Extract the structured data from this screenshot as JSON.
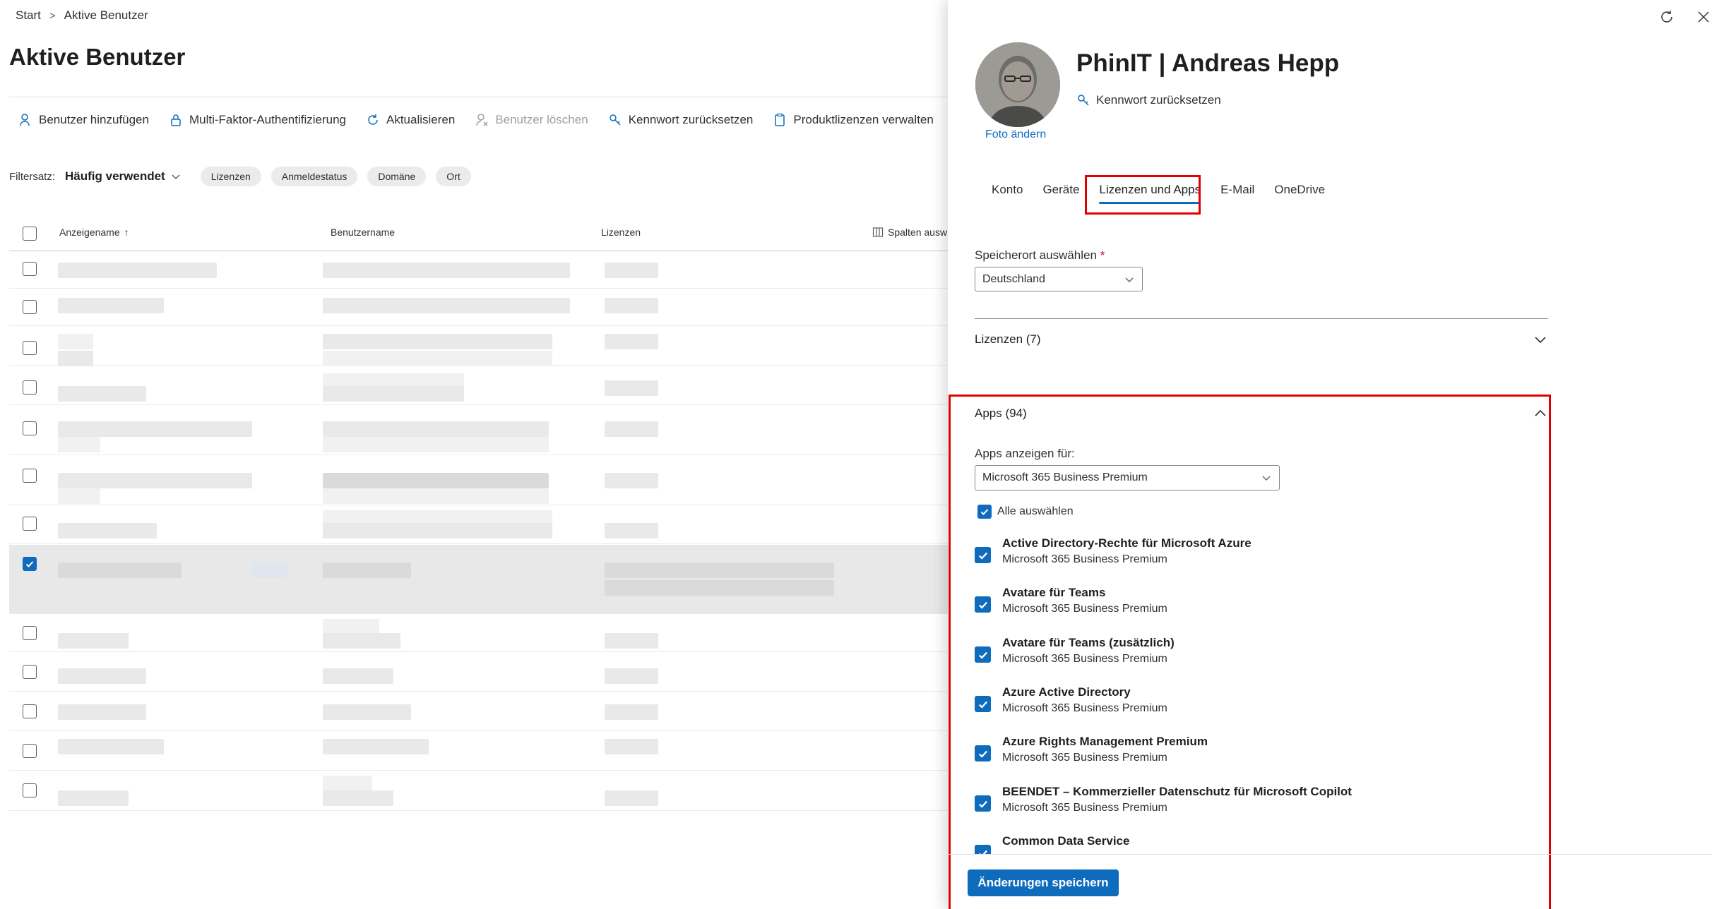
{
  "breadcrumb": {
    "home": "Start",
    "current": "Aktive Benutzer"
  },
  "page": {
    "title": "Aktive Benutzer"
  },
  "toolbar": {
    "add_user": "Benutzer hinzufügen",
    "mfa": "Multi-Faktor-Authentifizierung",
    "refresh": "Aktualisieren",
    "delete_user": "Benutzer löschen",
    "reset_password": "Kennwort zurücksetzen",
    "manage_licenses": "Produktlizenzen verwalten"
  },
  "filter": {
    "label": "Filtersatz:",
    "selected": "Häufig verwendet",
    "pills": [
      "Lizenzen",
      "Anmeldestatus",
      "Domäne",
      "Ort"
    ]
  },
  "table": {
    "columns": {
      "display_name": "Anzeigename",
      "username": "Benutzername",
      "licenses": "Lizenzen",
      "choose_columns": "Spalten ausw"
    }
  },
  "panel": {
    "user_name": "PhinIT | Andreas Hepp",
    "change_photo": "Foto ändern",
    "reset_password": "Kennwort zurücksetzen",
    "tabs": [
      "Konto",
      "Geräte",
      "Lizenzen und Apps",
      "E-Mail",
      "OneDrive"
    ],
    "active_tab": "Lizenzen und Apps",
    "location_label": "Speicherort auswählen",
    "location_required": "*",
    "location_value": "Deutschland",
    "licenses_header": "Lizenzen (7)",
    "apps_header": "Apps (94)",
    "apps_show_for_label": "Apps anzeigen für:",
    "apps_show_for_value": "Microsoft 365 Business Premium",
    "select_all": "Alle auswählen",
    "apps": [
      {
        "name": "Active Directory-Rechte für Microsoft Azure",
        "plan": "Microsoft 365 Business Premium",
        "checked": true
      },
      {
        "name": "Avatare für Teams",
        "plan": "Microsoft 365 Business Premium",
        "checked": true
      },
      {
        "name": "Avatare für Teams (zusätzlich)",
        "plan": "Microsoft 365 Business Premium",
        "checked": true
      },
      {
        "name": "Azure Active Directory",
        "plan": "Microsoft 365 Business Premium",
        "checked": true
      },
      {
        "name": "Azure Rights Management Premium",
        "plan": "Microsoft 365 Business Premium",
        "checked": true
      },
      {
        "name": "BEENDET – Kommerzieller Datenschutz für Microsoft Copilot",
        "plan": "Microsoft 365 Business Premium",
        "checked": true
      },
      {
        "name": "Common Data Service",
        "plan": "",
        "checked": true
      }
    ],
    "save_button": "Änderungen speichern"
  },
  "colors": {
    "accent": "#0f6cbd",
    "highlight": "#e00000"
  }
}
